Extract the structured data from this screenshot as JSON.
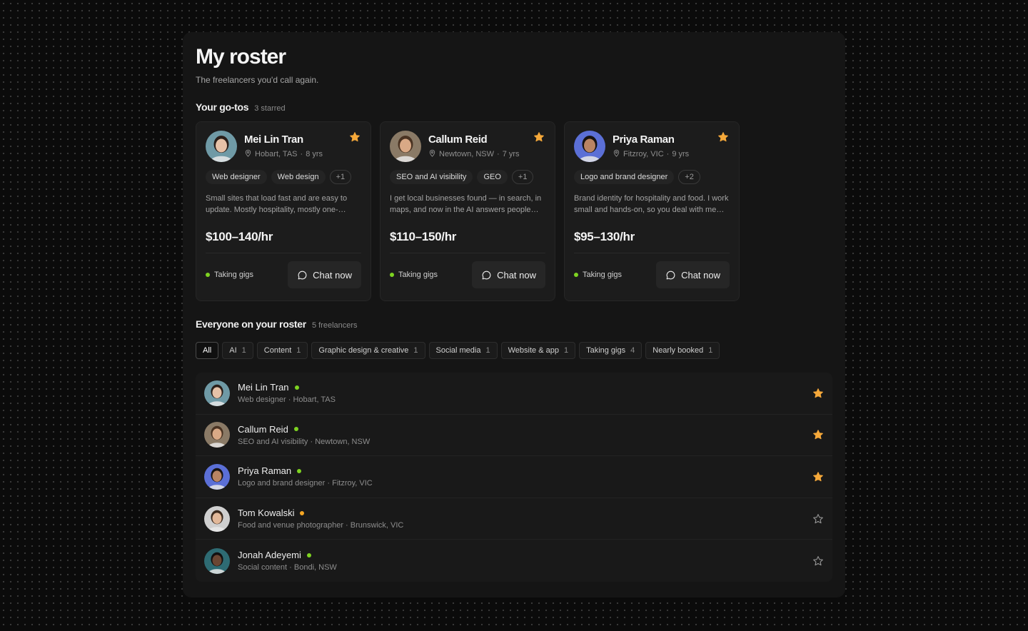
{
  "header": {
    "title": "My roster",
    "subtitle": "The freelancers you'd call again."
  },
  "gotos": {
    "title": "Your go-tos",
    "count_label": "3 starred",
    "cards": [
      {
        "name": "Mei Lin Tran",
        "location": "Hobart, TAS",
        "experience": "8 yrs",
        "tags": [
          "Web designer",
          "Web design"
        ],
        "more_tags": "+1",
        "description": "Small sites that load fast and are easy to update. Mostly hospitality, mostly one-person businesses.",
        "rate": "$100–140/hr",
        "status": "Taking gigs",
        "status_color": "#7ed321",
        "chat_label": "Chat now",
        "avatar_bg": "#6f9aa6",
        "avatar_skin": "#e6c2a8",
        "avatar_hair": "#2a1f1a"
      },
      {
        "name": "Callum Reid",
        "location": "Newtown, NSW",
        "experience": "7 yrs",
        "tags": [
          "SEO and AI visibility",
          "GEO"
        ],
        "more_tags": "+1",
        "description": "I get local businesses found — in search, in maps, and now in the AI answers people ask.",
        "rate": "$110–150/hr",
        "status": "Taking gigs",
        "status_color": "#7ed321",
        "chat_label": "Chat now",
        "avatar_bg": "#8a7a66",
        "avatar_skin": "#d9a986",
        "avatar_hair": "#4a3322"
      },
      {
        "name": "Priya Raman",
        "location": "Fitzroy, VIC",
        "experience": "9 yrs",
        "tags": [
          "Logo and brand designer"
        ],
        "more_tags": "+2",
        "description": "Brand identity for hospitality and food. I work small and hands-on, so you deal with me directly.",
        "rate": "$95–130/hr",
        "status": "Taking gigs",
        "status_color": "#7ed321",
        "chat_label": "Chat now",
        "avatar_bg": "#5b6fd6",
        "avatar_skin": "#b98463",
        "avatar_hair": "#171312"
      }
    ]
  },
  "roster": {
    "title": "Everyone on your roster",
    "count_label": "5 freelancers",
    "filters": [
      {
        "label": "All",
        "count": "",
        "active": true
      },
      {
        "label": "AI",
        "count": "1"
      },
      {
        "label": "Content",
        "count": "1"
      },
      {
        "label": "Graphic design & creative",
        "count": "1"
      },
      {
        "label": "Social media",
        "count": "1"
      },
      {
        "label": "Website & app",
        "count": "1"
      },
      {
        "label": "Taking gigs",
        "count": "4"
      },
      {
        "label": "Nearly booked",
        "count": "1"
      }
    ],
    "rows": [
      {
        "name": "Mei Lin Tran",
        "subtitle": "Web designer · Hobart, TAS",
        "status_color": "#7ed321",
        "starred": true,
        "avatar_bg": "#6f9aa6",
        "avatar_skin": "#e6c2a8",
        "avatar_hair": "#2a1f1a"
      },
      {
        "name": "Callum Reid",
        "subtitle": "SEO and AI visibility · Newtown, NSW",
        "status_color": "#7ed321",
        "starred": true,
        "avatar_bg": "#8a7a66",
        "avatar_skin": "#d9a986",
        "avatar_hair": "#4a3322"
      },
      {
        "name": "Priya Raman",
        "subtitle": "Logo and brand designer · Fitzroy, VIC",
        "status_color": "#7ed321",
        "starred": true,
        "avatar_bg": "#5b6fd6",
        "avatar_skin": "#b98463",
        "avatar_hair": "#171312"
      },
      {
        "name": "Tom Kowalski",
        "subtitle": "Food and venue photographer · Brunswick, VIC",
        "status_color": "#f5a623",
        "starred": false,
        "avatar_bg": "#cfcfcf",
        "avatar_skin": "#e2b899",
        "avatar_hair": "#3b2a1e"
      },
      {
        "name": "Jonah Adeyemi",
        "subtitle": "Social content · Bondi, NSW",
        "status_color": "#7ed321",
        "starred": false,
        "avatar_bg": "#2e6b73",
        "avatar_skin": "#6b4633",
        "avatar_hair": "#121010"
      }
    ]
  },
  "colors": {
    "star": "#f5a83a",
    "star_outline": "#9a9a9a"
  }
}
